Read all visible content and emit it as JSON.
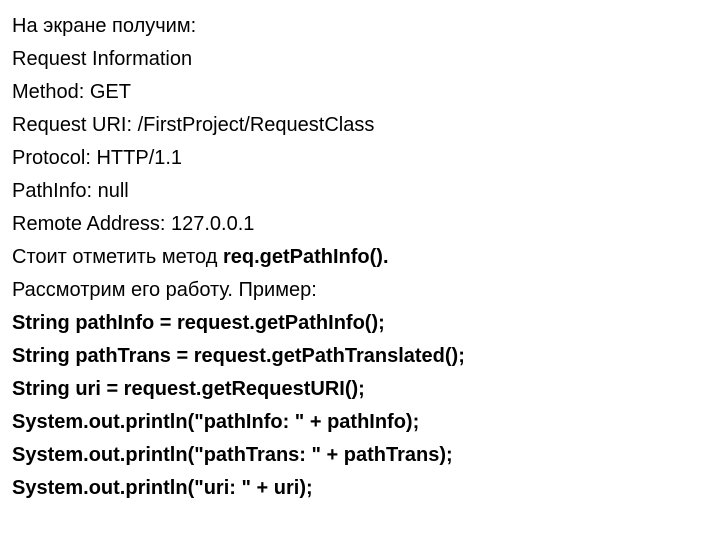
{
  "lines": [
    {
      "text": "На экране получим:",
      "bold": false
    },
    {
      "text": "Request Information",
      "bold": false
    },
    {
      "text": "Method: GET",
      "bold": false
    },
    {
      "text": "Request URI: /FirstProject/RequestClass",
      "bold": false
    },
    {
      "text": "Protocol: HTTP/1.1",
      "bold": false
    },
    {
      "text": "PathInfo: null",
      "bold": false
    },
    {
      "text": "Remote Address: 127.0.0.1",
      "bold": false
    }
  ],
  "note": {
    "prefix": "Стоит отметить метод ",
    "method": "req.getPathInfo()."
  },
  "example_intro": "Рассмотрим его работу. Пример:",
  "code": [
    "String pathInfo = request.getPathInfo();",
    "String pathTrans = request.getPathTranslated();",
    "String uri = request.getRequestURI();",
    "System.out.println(\"pathInfo: \" + pathInfo);",
    "System.out.println(\"pathTrans: \" + pathTrans);",
    "System.out.println(\"uri: \" + uri);"
  ]
}
